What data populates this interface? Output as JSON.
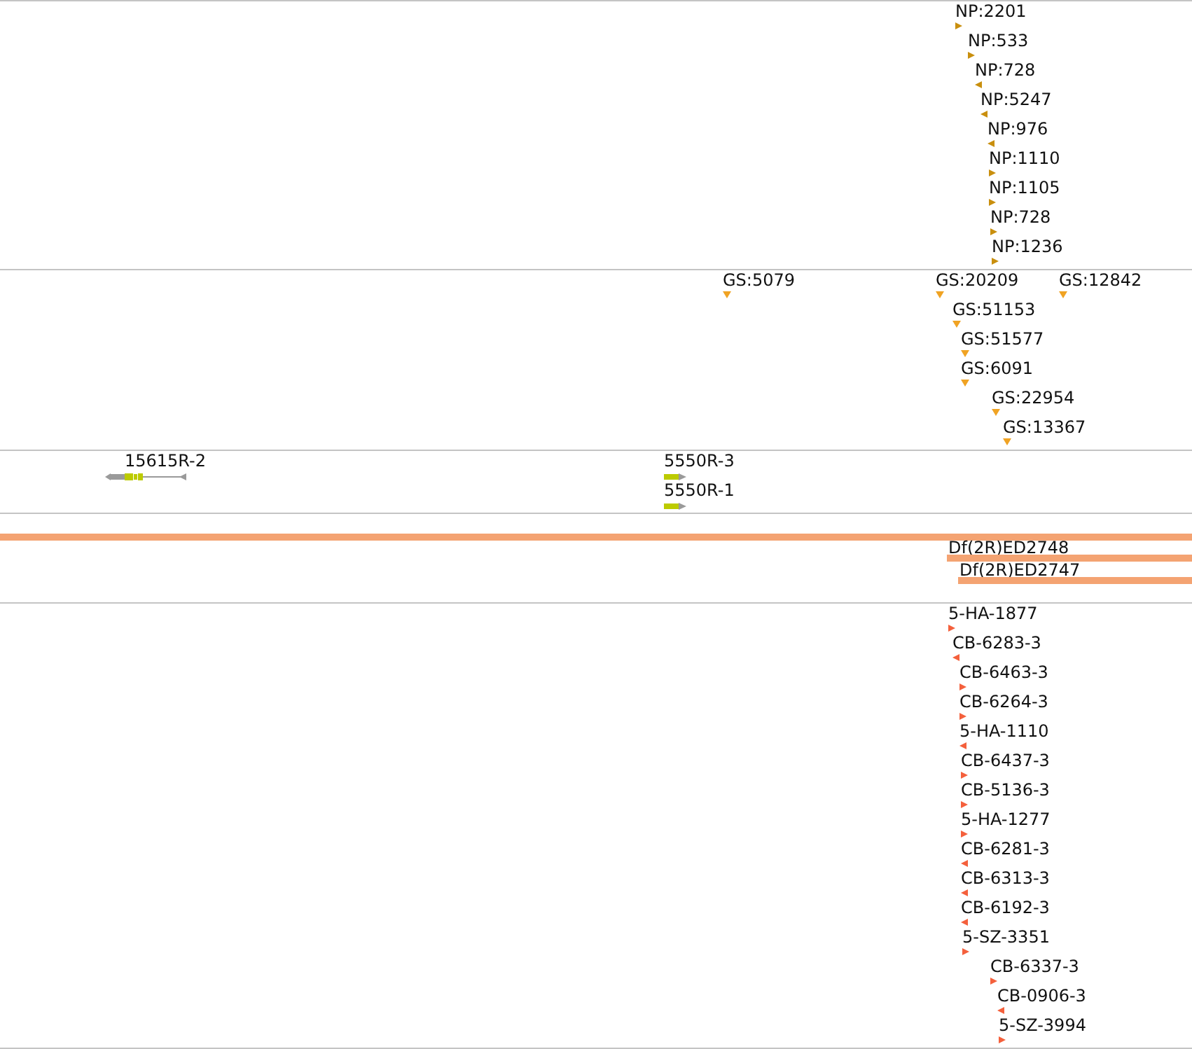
{
  "tracks": [
    {
      "kind": "markers",
      "features": [
        {
          "label": "NP:2201",
          "reverse": false
        },
        {
          "label": "NP:533",
          "reverse": false
        },
        {
          "label": "NP:728",
          "reverse": true
        },
        {
          "label": "NP:5247",
          "reverse": true
        },
        {
          "label": "NP:976",
          "reverse": true
        },
        {
          "label": "NP:1110",
          "reverse": false
        },
        {
          "label": "NP:1105",
          "reverse": false
        },
        {
          "label": "NP:728",
          "reverse": false
        },
        {
          "label": "NP:1236",
          "reverse": false
        }
      ]
    },
    {
      "kind": "markers",
      "features": [
        {
          "label": "GS:5079"
        },
        {
          "label": "GS:20209"
        },
        {
          "label": "GS:12842"
        },
        {
          "label": "GS:51153"
        },
        {
          "label": "GS:51577"
        },
        {
          "label": "GS:6091"
        },
        {
          "label": "GS:22954"
        },
        {
          "label": "GS:13367"
        }
      ]
    },
    {
      "kind": "transcripts",
      "features": [
        {
          "label": "15615R-2",
          "reverse": true
        },
        {
          "label": "5550R-3",
          "reverse": false
        },
        {
          "label": "5550R-1",
          "reverse": false
        }
      ]
    },
    {
      "kind": "bars",
      "unlabeled_bar": true,
      "features": [
        {
          "label": "Df(2R)ED2748"
        },
        {
          "label": "Df(2R)ED2747"
        }
      ]
    },
    {
      "kind": "markers",
      "features": [
        {
          "label": "5-HA-1877",
          "reverse": false
        },
        {
          "label": "CB-6283-3",
          "reverse": true
        },
        {
          "label": "CB-6463-3",
          "reverse": false
        },
        {
          "label": "CB-6264-3",
          "reverse": false
        },
        {
          "label": "5-HA-1110",
          "reverse": true
        },
        {
          "label": "CB-6437-3",
          "reverse": false
        },
        {
          "label": "CB-5136-3",
          "reverse": false
        },
        {
          "label": "5-HA-1277",
          "reverse": false
        },
        {
          "label": "CB-6281-3",
          "reverse": true
        },
        {
          "label": "CB-6313-3",
          "reverse": true
        },
        {
          "label": "CB-6192-3",
          "reverse": true
        },
        {
          "label": "5-SZ-3351",
          "reverse": false
        },
        {
          "label": "CB-6337-3",
          "reverse": false
        },
        {
          "label": "CB-0906-3",
          "reverse": true
        },
        {
          "label": "5-SZ-3994",
          "reverse": false
        }
      ]
    }
  ]
}
